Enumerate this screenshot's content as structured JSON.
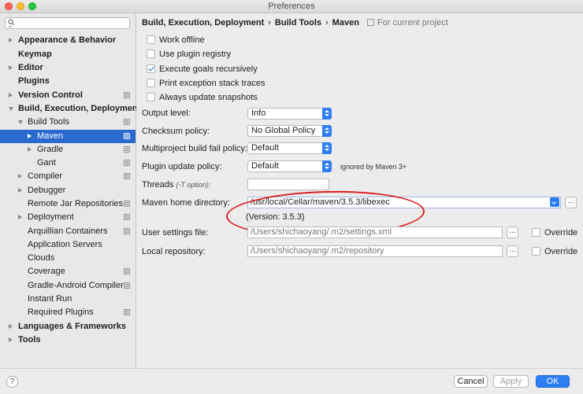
{
  "window": {
    "title": "Preferences"
  },
  "sidebar": {
    "items": [
      {
        "label": "Appearance & Behavior",
        "bold": true,
        "arrow": "right",
        "indent": 0
      },
      {
        "label": "Keymap",
        "bold": true,
        "arrow": "",
        "indent": 0
      },
      {
        "label": "Editor",
        "bold": true,
        "arrow": "right",
        "indent": 0
      },
      {
        "label": "Plugins",
        "bold": true,
        "arrow": "",
        "indent": 0
      },
      {
        "label": "Version Control",
        "bold": true,
        "arrow": "right",
        "indent": 0,
        "icon": true
      },
      {
        "label": "Build, Execution, Deployment",
        "bold": true,
        "arrow": "down",
        "indent": 0
      },
      {
        "label": "Build Tools",
        "bold": false,
        "arrow": "down",
        "indent": 1,
        "icon": true
      },
      {
        "label": "Maven",
        "bold": false,
        "arrow": "right",
        "indent": 2,
        "icon": true,
        "selected": true
      },
      {
        "label": "Gradle",
        "bold": false,
        "arrow": "right",
        "indent": 2,
        "icon": true
      },
      {
        "label": "Gant",
        "bold": false,
        "arrow": "",
        "indent": 2,
        "icon": true
      },
      {
        "label": "Compiler",
        "bold": false,
        "arrow": "right",
        "indent": 1,
        "icon": true
      },
      {
        "label": "Debugger",
        "bold": false,
        "arrow": "right",
        "indent": 1
      },
      {
        "label": "Remote Jar Repositories",
        "bold": false,
        "arrow": "",
        "indent": 1,
        "icon": true
      },
      {
        "label": "Deployment",
        "bold": false,
        "arrow": "right",
        "indent": 1,
        "icon": true
      },
      {
        "label": "Arquillian Containers",
        "bold": false,
        "arrow": "",
        "indent": 1,
        "icon": true
      },
      {
        "label": "Application Servers",
        "bold": false,
        "arrow": "",
        "indent": 1
      },
      {
        "label": "Clouds",
        "bold": false,
        "arrow": "",
        "indent": 1
      },
      {
        "label": "Coverage",
        "bold": false,
        "arrow": "",
        "indent": 1,
        "icon": true
      },
      {
        "label": "Gradle-Android Compiler",
        "bold": false,
        "arrow": "",
        "indent": 1,
        "icon": true
      },
      {
        "label": "Instant Run",
        "bold": false,
        "arrow": "",
        "indent": 1
      },
      {
        "label": "Required Plugins",
        "bold": false,
        "arrow": "",
        "indent": 1,
        "icon": true
      },
      {
        "label": "Languages & Frameworks",
        "bold": true,
        "arrow": "right",
        "indent": 0
      },
      {
        "label": "Tools",
        "bold": true,
        "arrow": "right",
        "indent": 0
      }
    ]
  },
  "breadcrumb": {
    "items": [
      "Build, Execution, Deployment",
      "Build Tools",
      "Maven"
    ],
    "scope": "For current project"
  },
  "options": {
    "work_offline": {
      "label": "Work offline",
      "checked": false
    },
    "plugin_registry": {
      "label": "Use plugin registry",
      "checked": false
    },
    "execute_goals": {
      "label": "Execute goals recursively",
      "checked": true
    },
    "print_exception": {
      "label": "Print exception stack traces",
      "checked": false
    },
    "update_snapshots": {
      "label": "Always update snapshots",
      "checked": false
    }
  },
  "fields": {
    "output_level": {
      "label": "Output level:",
      "value": "Info"
    },
    "checksum_policy": {
      "label": "Checksum policy:",
      "value": "No Global Policy"
    },
    "multiproject_fail": {
      "label": "Multiproject build fail policy:",
      "value": "Default"
    },
    "plugin_update": {
      "label": "Plugin update policy:",
      "value": "Default",
      "note": "ignored by Maven 3+"
    },
    "threads": {
      "label": "Threads",
      "hint": "(-T option):",
      "value": ""
    },
    "maven_home": {
      "label": "Maven home directory:",
      "value": "/usr/local/Cellar/maven/3.5.3/libexec",
      "version": "(Version: 3.5.3)"
    },
    "user_settings": {
      "label": "User settings file:",
      "value": "/Users/shichaoyang/.m2/settings.xml",
      "override": "Override"
    },
    "local_repo": {
      "label": "Local repository:",
      "value": "/Users/shichaoyang/.m2/repository",
      "override": "Override"
    }
  },
  "buttons": {
    "help": "?",
    "cancel": "Cancel",
    "apply": "Apply",
    "ok": "OK",
    "browse": "..."
  }
}
